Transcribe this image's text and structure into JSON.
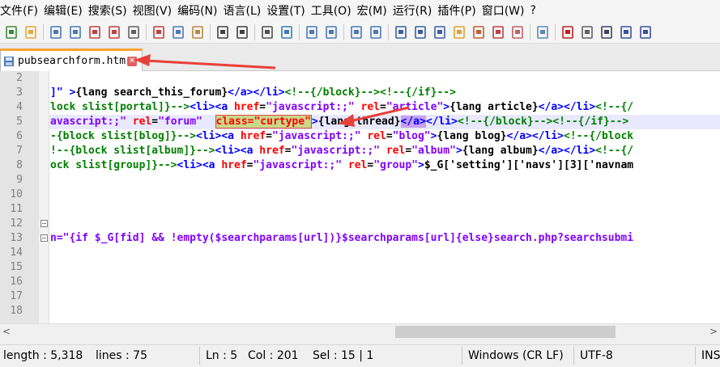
{
  "menu": [
    "文件(F)",
    "编辑(E)",
    "搜索(S)",
    "视图(V)",
    "编码(N)",
    "语言(L)",
    "设置(T)",
    "工具(O)",
    "宏(M)",
    "运行(R)",
    "插件(P)",
    "窗口(W)",
    "?"
  ],
  "toolbar_icons": [
    "new-file-icon",
    "open-file-icon",
    "save-icon",
    "save-all-icon",
    "close-icon",
    "close-all-icon",
    "print-icon",
    "cut-icon",
    "copy-icon",
    "paste-icon",
    "undo-icon",
    "redo-icon",
    "find-icon",
    "replace-icon",
    "zoom-in-icon",
    "zoom-out-icon",
    "sync-v-icon",
    "sync-h-icon",
    "word-wrap-icon",
    "show-all-chars-icon",
    "indent-guide-icon",
    "udl-icon",
    "doc-map-icon",
    "function-list-icon",
    "folder-workspace-icon",
    "monitor-icon",
    "record-macro-icon",
    "stop-macro-icon",
    "play-macro-icon",
    "run-macro-multi-icon",
    "save-macro-icon"
  ],
  "tab": {
    "name": "pubsearchform.htm",
    "close_glyph": "✕"
  },
  "editor": {
    "lines": [
      {
        "num": "2",
        "segments": []
      },
      {
        "num": "3",
        "segments": [
          {
            "t": "]\" >",
            "c": "c-blue"
          },
          {
            "t": "{lang search_this_forum}",
            "c": "c-dark"
          },
          {
            "t": "</a></li>",
            "c": "c-blue"
          },
          {
            "t": "<!--{/block}--><!--{/if}-->",
            "c": "c-green"
          }
        ]
      },
      {
        "num": "4",
        "segments": [
          {
            "t": "lock slist[portal]}-->",
            "c": "c-green"
          },
          {
            "t": "<li><a ",
            "c": "c-blue"
          },
          {
            "t": "href",
            "c": "c-red"
          },
          {
            "t": "=",
            "c": "c-dark"
          },
          {
            "t": "\"javascript:;\"",
            "c": "c-purple"
          },
          {
            "t": " ",
            "c": "c-dark"
          },
          {
            "t": "rel",
            "c": "c-red"
          },
          {
            "t": "=",
            "c": "c-dark"
          },
          {
            "t": "\"article\"",
            "c": "c-purple"
          },
          {
            "t": ">",
            "c": "c-blue"
          },
          {
            "t": "{lang article}",
            "c": "c-dark"
          },
          {
            "t": "</a></li>",
            "c": "c-blue"
          },
          {
            "t": "<!--{/",
            "c": "c-green"
          }
        ]
      },
      {
        "num": "5",
        "segments": [
          {
            "t": "avascript:;\"",
            "c": "c-purple"
          },
          {
            "t": " ",
            "c": "c-dark"
          },
          {
            "t": "rel",
            "c": "c-red"
          },
          {
            "t": "=",
            "c": "c-dark"
          },
          {
            "t": "\"forum\"",
            "c": "c-purple"
          },
          {
            "t": "  ",
            "c": "c-dark"
          },
          {
            "t": "class=\"curtype\"",
            "c": "c-red",
            "hl": "hl-class"
          },
          {
            "t": ">",
            "c": "c-blue"
          },
          {
            "t": "{lang thread}",
            "c": "c-dark"
          },
          {
            "t": "</a>",
            "c": "c-blue",
            "hl": "hl-tag"
          },
          {
            "t": "</li>",
            "c": "c-blue"
          },
          {
            "t": "<!--{/block}--><!--{/if}-->",
            "c": "c-green"
          }
        ]
      },
      {
        "num": "6",
        "segments": [
          {
            "t": "-{block slist[blog]}-->",
            "c": "c-green"
          },
          {
            "t": "<li><a ",
            "c": "c-blue"
          },
          {
            "t": "href",
            "c": "c-red"
          },
          {
            "t": "=",
            "c": "c-dark"
          },
          {
            "t": "\"javascript:;\"",
            "c": "c-purple"
          },
          {
            "t": " ",
            "c": "c-dark"
          },
          {
            "t": "rel",
            "c": "c-red"
          },
          {
            "t": "=",
            "c": "c-dark"
          },
          {
            "t": "\"blog\"",
            "c": "c-purple"
          },
          {
            "t": ">",
            "c": "c-blue"
          },
          {
            "t": "{lang blog}",
            "c": "c-dark"
          },
          {
            "t": "</a></li>",
            "c": "c-blue"
          },
          {
            "t": "<!--{/block",
            "c": "c-green"
          }
        ]
      },
      {
        "num": "7",
        "segments": [
          {
            "t": "!--{block slist[album]}-->",
            "c": "c-green"
          },
          {
            "t": "<li><a ",
            "c": "c-blue"
          },
          {
            "t": "href",
            "c": "c-red"
          },
          {
            "t": "=",
            "c": "c-dark"
          },
          {
            "t": "\"javascript:;\"",
            "c": "c-purple"
          },
          {
            "t": " ",
            "c": "c-dark"
          },
          {
            "t": "rel",
            "c": "c-red"
          },
          {
            "t": "=",
            "c": "c-dark"
          },
          {
            "t": "\"album\"",
            "c": "c-purple"
          },
          {
            "t": ">",
            "c": "c-blue"
          },
          {
            "t": "{lang album}",
            "c": "c-dark"
          },
          {
            "t": "</a></li>",
            "c": "c-blue"
          },
          {
            "t": "<!--{/",
            "c": "c-green"
          }
        ]
      },
      {
        "num": "8",
        "segments": [
          {
            "t": "ock slist[group]}-->",
            "c": "c-green"
          },
          {
            "t": "<li><a ",
            "c": "c-blue"
          },
          {
            "t": "href",
            "c": "c-red"
          },
          {
            "t": "=",
            "c": "c-dark"
          },
          {
            "t": "\"javascript:;\"",
            "c": "c-purple"
          },
          {
            "t": " ",
            "c": "c-dark"
          },
          {
            "t": "rel",
            "c": "c-red"
          },
          {
            "t": "=",
            "c": "c-dark"
          },
          {
            "t": "\"group\"",
            "c": "c-purple"
          },
          {
            "t": ">",
            "c": "c-blue"
          },
          {
            "t": "$_G['setting']['navs'][3]['navnam",
            "c": "c-dark"
          }
        ]
      },
      {
        "num": "9",
        "segments": []
      },
      {
        "num": "10",
        "segments": []
      },
      {
        "num": "11",
        "segments": []
      },
      {
        "num": "12",
        "segments": [],
        "fold": true
      },
      {
        "num": "13",
        "segments": [
          {
            "t": "n=\"{if $_G[fid] && !empty($searchparams[url])}$searchparams[url]{else}search.php?searchsubmi",
            "c": "c-purple"
          }
        ],
        "fold": true
      },
      {
        "num": "14",
        "segments": []
      },
      {
        "num": "15",
        "segments": []
      },
      {
        "num": "16",
        "segments": []
      },
      {
        "num": "17",
        "segments": []
      },
      {
        "num": "18",
        "segments": []
      }
    ]
  },
  "scrollbar": {
    "left_glyph": "<",
    "right_glyph": ">"
  },
  "status": {
    "length": "length : 5,318",
    "lines": "lines : 75",
    "ln": "Ln : 5",
    "col": "Col : 201",
    "sel": "Sel : 15 | 1",
    "eol": "Windows (CR LF)",
    "encoding": "UTF-8",
    "mode": "INS"
  },
  "colors": {
    "tab_accent": "#f7a233",
    "arrow": "#e8403a"
  }
}
